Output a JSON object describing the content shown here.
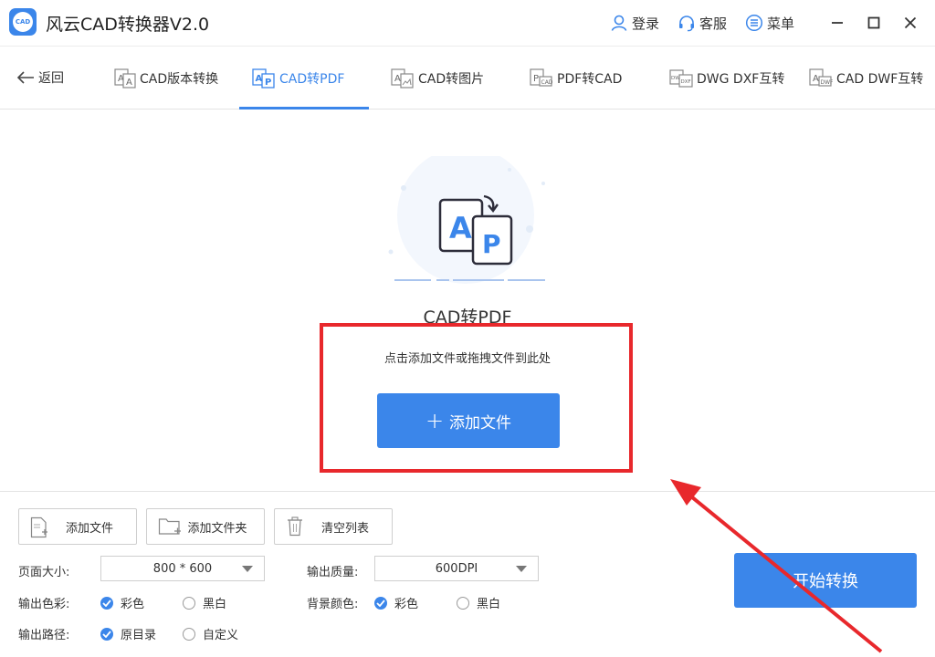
{
  "app": {
    "title": "风云CAD转换器V2.0",
    "logo_text": "CAD"
  },
  "titlebar": {
    "login_label": "登录",
    "service_label": "客服",
    "menu_label": "菜单"
  },
  "nav": {
    "back_label": "返回",
    "tabs": [
      {
        "label": "CAD版本转换",
        "active": false
      },
      {
        "label": "CAD转PDF",
        "active": true
      },
      {
        "label": "CAD转图片",
        "active": false
      },
      {
        "label": "PDF转CAD",
        "active": false
      },
      {
        "label": "DWG DXF互转",
        "active": false
      },
      {
        "label": "CAD DWF互转",
        "active": false
      }
    ]
  },
  "drop": {
    "title": "CAD转PDF",
    "hint": "点击添加文件或拖拽文件到此处",
    "add_button_label": "添加文件"
  },
  "toolbar": {
    "add_file_label": "添加文件",
    "add_folder_label": "添加文件夹",
    "clear_list_label": "清空列表"
  },
  "settings": {
    "page_size_label": "页面大小:",
    "page_size_value": "800 * 600",
    "quality_label": "输出质量:",
    "quality_value": "600DPI",
    "output_color_label": "输出色彩:",
    "output_color_options": [
      "彩色",
      "黑白"
    ],
    "output_color_selected": "彩色",
    "bg_color_label": "背景颜色:",
    "bg_color_options": [
      "彩色",
      "黑白"
    ],
    "bg_color_selected": "彩色",
    "output_path_label": "输出路径:",
    "output_path_options": [
      "原目录",
      "自定义"
    ],
    "output_path_selected": "原目录"
  },
  "start_button_label": "开始转换",
  "colors": {
    "accent": "#3b86ea",
    "highlight_red": "#e8282c"
  }
}
